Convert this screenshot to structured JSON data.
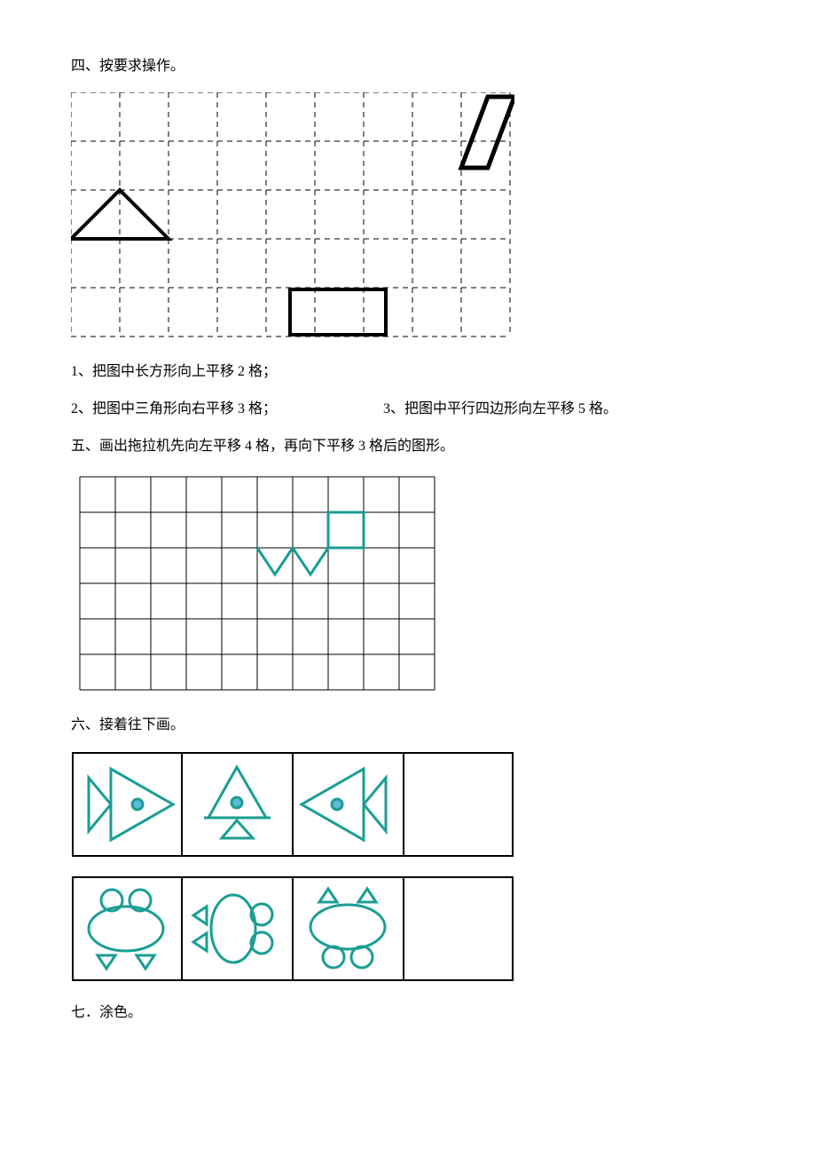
{
  "section4": {
    "heading": "四、按要求操作。",
    "item1": "1、把图中长方形向上平移 2 格；",
    "item2": "2、把图中三角形向右平移 3 格；",
    "item3": "3、把图中平行四边形向左平移 5 格。"
  },
  "section5": {
    "heading": "五、画出拖拉机先向左平移 4 格，再向下平移 3 格后的图形。"
  },
  "section6": {
    "heading": "六、接着往下画。"
  },
  "section7": {
    "heading": "七．涂色。"
  }
}
